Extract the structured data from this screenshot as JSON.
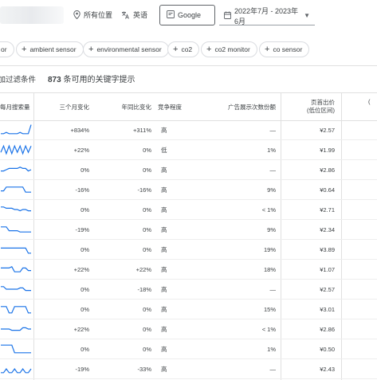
{
  "topbar": {
    "location": "所有位置",
    "language": "英语",
    "engine": "Google",
    "date_range": "2022年7月 - 2023年6月"
  },
  "chips": [
    {
      "label": "or"
    },
    {
      "label": "ambient sensor"
    },
    {
      "label": "environmental sensor"
    },
    {
      "label": "co2"
    },
    {
      "label": "co2 monitor"
    },
    {
      "label": "co sensor"
    }
  ],
  "filter": {
    "add_label": "添加过滤条件",
    "count_number": "873",
    "count_text": "条可用的关键字提示"
  },
  "table": {
    "headers": {
      "volume": "每月搜索量",
      "three_month": "三个月变化",
      "yoy": "年同比变化",
      "competition": "竞争程度",
      "impression_share": "广告展示次数份额",
      "bid_line1": "页首出价",
      "bid_line2": "(低位区间)",
      "bid_high_partial": "("
    },
    "rows": [
      {
        "three_month": "+834%",
        "yoy": "+311%",
        "competition": "高",
        "share": "—",
        "bid": "¥2.57",
        "trend": [
          2,
          2,
          3,
          2,
          2,
          2,
          2,
          3,
          2,
          2,
          2,
          9
        ]
      },
      {
        "three_month": "+22%",
        "yoy": "0%",
        "competition": "低",
        "share": "1%",
        "bid": "¥1.99",
        "trend": [
          3,
          8,
          2,
          8,
          2,
          8,
          3,
          8,
          2,
          8,
          3,
          8
        ]
      },
      {
        "three_month": "0%",
        "yoy": "0%",
        "competition": "高",
        "share": "—",
        "bid": "¥2.86",
        "trend": [
          4,
          4,
          5,
          6,
          6,
          6,
          6,
          7,
          6,
          6,
          4,
          5
        ]
      },
      {
        "three_month": "-16%",
        "yoy": "-16%",
        "competition": "高",
        "share": "9%",
        "bid": "¥0.64",
        "trend": [
          4,
          4,
          7,
          7,
          7,
          7,
          7,
          7,
          7,
          3,
          3,
          3
        ]
      },
      {
        "three_month": "0%",
        "yoy": "0%",
        "competition": "高",
        "share": "< 1%",
        "bid": "¥2.71",
        "trend": [
          7,
          7,
          6,
          6,
          6,
          5,
          5,
          4,
          5,
          5,
          4,
          4
        ]
      },
      {
        "three_month": "-19%",
        "yoy": "0%",
        "competition": "高",
        "share": "9%",
        "bid": "¥2.34",
        "trend": [
          7,
          7,
          7,
          4,
          4,
          4,
          4,
          3,
          3,
          3,
          3,
          3
        ]
      },
      {
        "three_month": "0%",
        "yoy": "0%",
        "competition": "高",
        "share": "19%",
        "bid": "¥3.89",
        "trend": [
          6,
          6,
          6,
          6,
          6,
          6,
          6,
          6,
          6,
          6,
          2,
          2
        ]
      },
      {
        "three_month": "+22%",
        "yoy": "+22%",
        "competition": "高",
        "share": "18%",
        "bid": "¥1.07",
        "trend": [
          6,
          6,
          6,
          6,
          7,
          3,
          3,
          3,
          6,
          6,
          4,
          4
        ]
      },
      {
        "three_month": "0%",
        "yoy": "-18%",
        "competition": "高",
        "share": "—",
        "bid": "¥2.57",
        "trend": [
          7,
          7,
          5,
          5,
          5,
          5,
          5,
          6,
          6,
          4,
          4,
          4
        ]
      },
      {
        "three_month": "0%",
        "yoy": "0%",
        "competition": "高",
        "share": "15%",
        "bid": "¥3.01",
        "trend": [
          7,
          7,
          7,
          2,
          2,
          7,
          7,
          7,
          7,
          7,
          2,
          2
        ]
      },
      {
        "three_month": "+22%",
        "yoy": "0%",
        "competition": "高",
        "share": "< 1%",
        "bid": "¥2.86",
        "trend": [
          5,
          5,
          5,
          5,
          4,
          4,
          4,
          4,
          6,
          6,
          5,
          5
        ]
      },
      {
        "three_month": "0%",
        "yoy": "0%",
        "competition": "高",
        "share": "1%",
        "bid": "¥0.50",
        "trend": [
          8,
          8,
          8,
          8,
          8,
          2,
          2,
          2,
          2,
          2,
          2,
          2
        ]
      },
      {
        "three_month": "-19%",
        "yoy": "-33%",
        "competition": "高",
        "share": "—",
        "bid": "¥2.43",
        "trend": [
          2,
          2,
          5,
          2,
          2,
          5,
          2,
          2,
          5,
          2,
          2,
          5
        ]
      }
    ]
  },
  "colors": {
    "spark": "#1a73e8",
    "border": "#e0e0e0",
    "text": "#3c4043"
  }
}
